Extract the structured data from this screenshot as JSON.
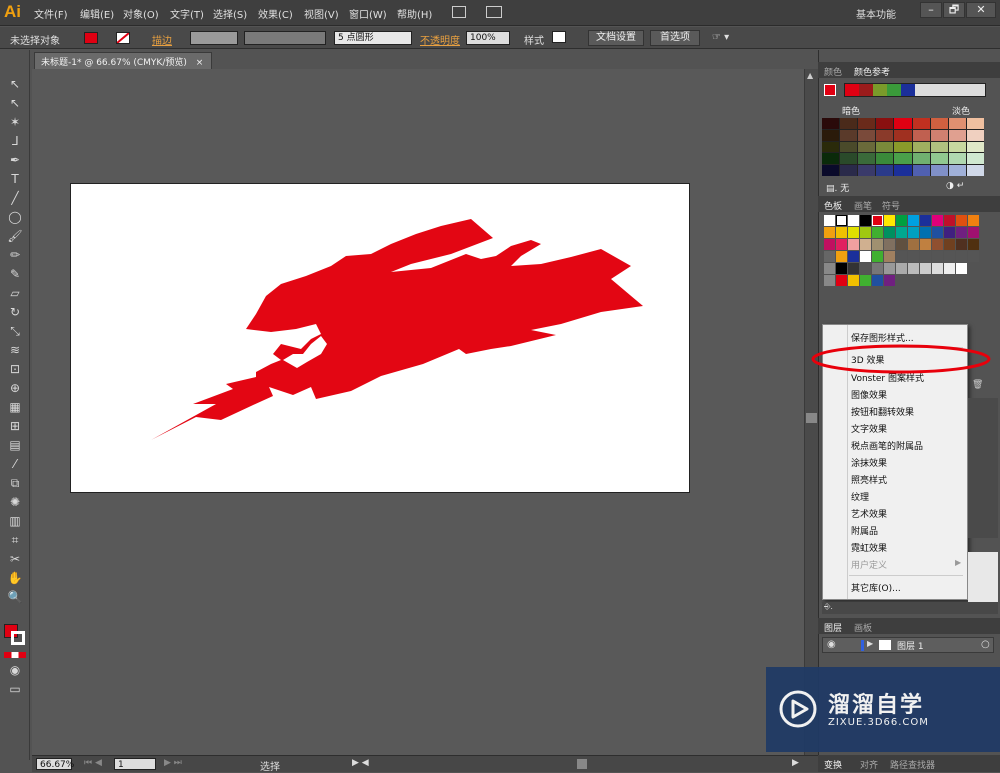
{
  "app": {
    "logo": "Ai"
  },
  "menu": [
    "文件(F)",
    "编辑(E)",
    "对象(O)",
    "文字(T)",
    "选择(S)",
    "效果(C)",
    "视图(V)",
    "窗口(W)",
    "帮助(H)"
  ],
  "workspace": "基本功能",
  "window_buttons": [
    "–",
    "🗗",
    "✕"
  ],
  "control": {
    "selection_label": "未选择对象",
    "stroke_label": "描边",
    "brush_value": "5 点圆形",
    "opacity_label": "不透明度",
    "opacity_value": "100%",
    "style_label": "样式",
    "doc_setup": "文档设置",
    "preferences": "首选项"
  },
  "document": {
    "tab_title": "未标题-1* @ 66.67% (CMYK/预览)",
    "close": "×"
  },
  "status": {
    "zoom": "66.67%",
    "page": "1",
    "mode": "选择"
  },
  "panels": {
    "color_tabs": [
      "颜色",
      "颜色参考"
    ],
    "dark_label": "暗色",
    "light_label": "淡色",
    "none_label": "无",
    "swatch_tabs": [
      "色板",
      "画笔",
      "符号"
    ],
    "layer_tabs": [
      "图层",
      "画板"
    ],
    "layer_name": "图层 1",
    "bottom_tabs": [
      "变换",
      "对齐",
      "路径查找器"
    ]
  },
  "context_menu": {
    "items": [
      "保存图形样式...",
      "3D 效果",
      "Vonster 图案样式",
      "图像效果",
      "按钮和翻转效果",
      "文字效果",
      "税点画笔的附属品",
      "涂抹效果",
      "照亮样式",
      "纹理",
      "艺术效果",
      "附属品",
      "霓虹效果",
      "用户定义",
      "其它库(O)..."
    ],
    "disabled_item": "用户定义",
    "highlighted_item": "3D 效果"
  },
  "watermark": {
    "title": "溜溜自学",
    "url": "ZIXUE.3D66.COM"
  },
  "colors": {
    "fill": "#e00012",
    "artwork": "#e30613",
    "highlight": "#e8000b"
  }
}
